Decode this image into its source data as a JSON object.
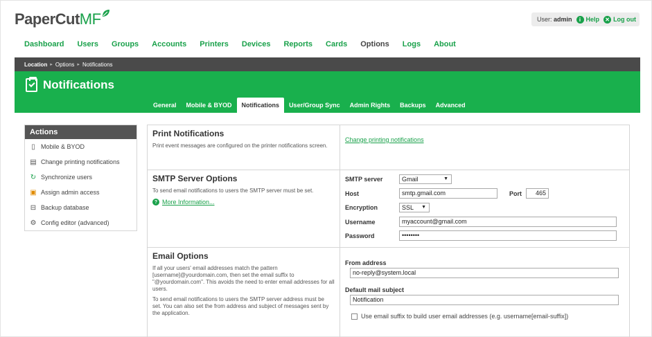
{
  "brand": {
    "name_a": "PaperCut",
    "name_b": "MF"
  },
  "user": {
    "label": "User:",
    "name": "admin",
    "help": "Help",
    "logout": "Log out"
  },
  "nav": [
    "Dashboard",
    "Users",
    "Groups",
    "Accounts",
    "Printers",
    "Devices",
    "Reports",
    "Cards",
    "Options",
    "Logs",
    "About"
  ],
  "nav_active": "Options",
  "breadcrumb": [
    "Location",
    "Options",
    "Notifications"
  ],
  "page_title": "Notifications",
  "subtabs": [
    "General",
    "Mobile & BYOD",
    "Notifications",
    "User/Group Sync",
    "Admin Rights",
    "Backups",
    "Advanced"
  ],
  "subtab_active": "Notifications",
  "actions": {
    "title": "Actions",
    "items": [
      {
        "label": "Mobile & BYOD",
        "icon": "mobile-icon"
      },
      {
        "label": "Change printing notifications",
        "icon": "printer-icon"
      },
      {
        "label": "Synchronize users",
        "icon": "sync-icon"
      },
      {
        "label": "Assign admin access",
        "icon": "lock-icon"
      },
      {
        "label": "Backup database",
        "icon": "database-icon"
      },
      {
        "label": "Config editor (advanced)",
        "icon": "gear-icon"
      }
    ]
  },
  "print_notifications": {
    "heading": "Print Notifications",
    "desc": "Print event messages are configured on the printer notifications screen.",
    "link": "Change printing notifications"
  },
  "smtp": {
    "heading": "SMTP Server Options",
    "desc": "To send email notifications to users the SMTP server must be set.",
    "more": "More Information...",
    "server_label": "SMTP server",
    "server_value": "Gmail",
    "host_label": "Host",
    "host_value": "smtp.gmail.com",
    "port_label": "Port",
    "port_value": "465",
    "encryption_label": "Encryption",
    "encryption_value": "SSL",
    "username_label": "Username",
    "username_value": "myaccount@gmail.com",
    "password_label": "Password",
    "password_value": "••••••••"
  },
  "email": {
    "heading": "Email Options",
    "desc1": "If all your users' email addresses match the pattern [username]@yourdomain.com, then set the email suffix to \"@yourdomain.com\". This avoids the need to enter email addresses for all users.",
    "desc2": "To send email notifications to users the SMTP server address must be set. You can also set the from address and subject of messages sent by the application.",
    "from_label": "From address",
    "from_value": "no-reply@system.local",
    "subject_label": "Default mail subject",
    "subject_value": "Notification",
    "suffix_label": "Use email suffix to build user email addresses (e.g. username[email-suffix])"
  }
}
